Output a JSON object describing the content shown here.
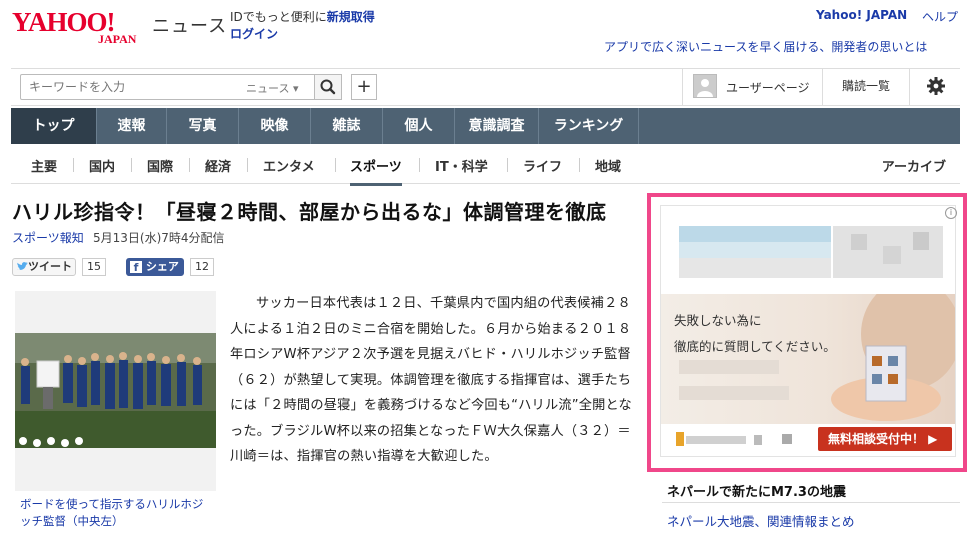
{
  "header": {
    "logo_main": "YAHOO!",
    "logo_sub": "JAPAN",
    "section_title": "ニュース",
    "promo_prefix": "IDでもっと便利に",
    "promo_link": "新規取得",
    "login": "ログイン",
    "yahoo_japan": "Yahoo! JAPAN",
    "help": "ヘルプ",
    "app_promo": "アプリで広く深いニュースを早く届ける、開発者の思いとは"
  },
  "search": {
    "placeholder": "キーワードを入力",
    "scope": "ニュース ▾",
    "plus": "+"
  },
  "user": {
    "user_page": "ユーザーページ",
    "subscriptions": "購読一覧"
  },
  "mainnav": [
    "トップ",
    "速報",
    "写真",
    "映像",
    "雑誌",
    "個人",
    "意識調査",
    "ランキング"
  ],
  "subnav": {
    "items": [
      "主要",
      "国内",
      "国際",
      "経済",
      "エンタメ",
      "スポーツ",
      "IT・科学",
      "ライフ",
      "地域"
    ],
    "archive": "アーカイブ"
  },
  "article": {
    "headline": "ハリル珍指令！「昼寝２時間、部屋から出るな」体調管理を徹底",
    "source": "スポーツ報知",
    "date": "5月13日(水)7時4分配信",
    "tweet_label": "ツイート",
    "tweet_count": "15",
    "share_label": "シェア",
    "share_count": "12",
    "photo_caption": "ボードを使って指示するハリルホジッチ監督（中央左）",
    "body": "サッカー日本代表は１２日、千葉県内で国内組の代表候補２８人による１泊２日のミニ合宿を開始した。６月から始まる２０１８年ロシアW杯アジア２次予選を見据えバヒド・ハリルホジッチ監督（６２）が熱望して実現。体調管理を徹底する指揮官は、選手たちには「２時間の昼寝」を義務づけるなど今回も“ハリル流”全開となった。ブラジルW杯以来の招集となったＦＷ大久保嘉人（３２）＝川崎＝は、指揮官の熱い指導を大歓迎した。"
  },
  "ad": {
    "line1": "失敗しない為に",
    "line2": "徹底的に質問してください。",
    "cta": "無料相談受付中！ ▶",
    "info": "i"
  },
  "sidebar": {
    "headline": "ネパールで新たにM7.3の地震",
    "link": "ネパール大地震、関連情報まとめ"
  },
  "colors": {
    "brand_red": "#e6002d",
    "nav_bg": "#4e6273",
    "nav_active": "#2f3e4b",
    "link": "#1a3aa8",
    "ad_border": "#f0478a",
    "cta": "#c8321e"
  }
}
